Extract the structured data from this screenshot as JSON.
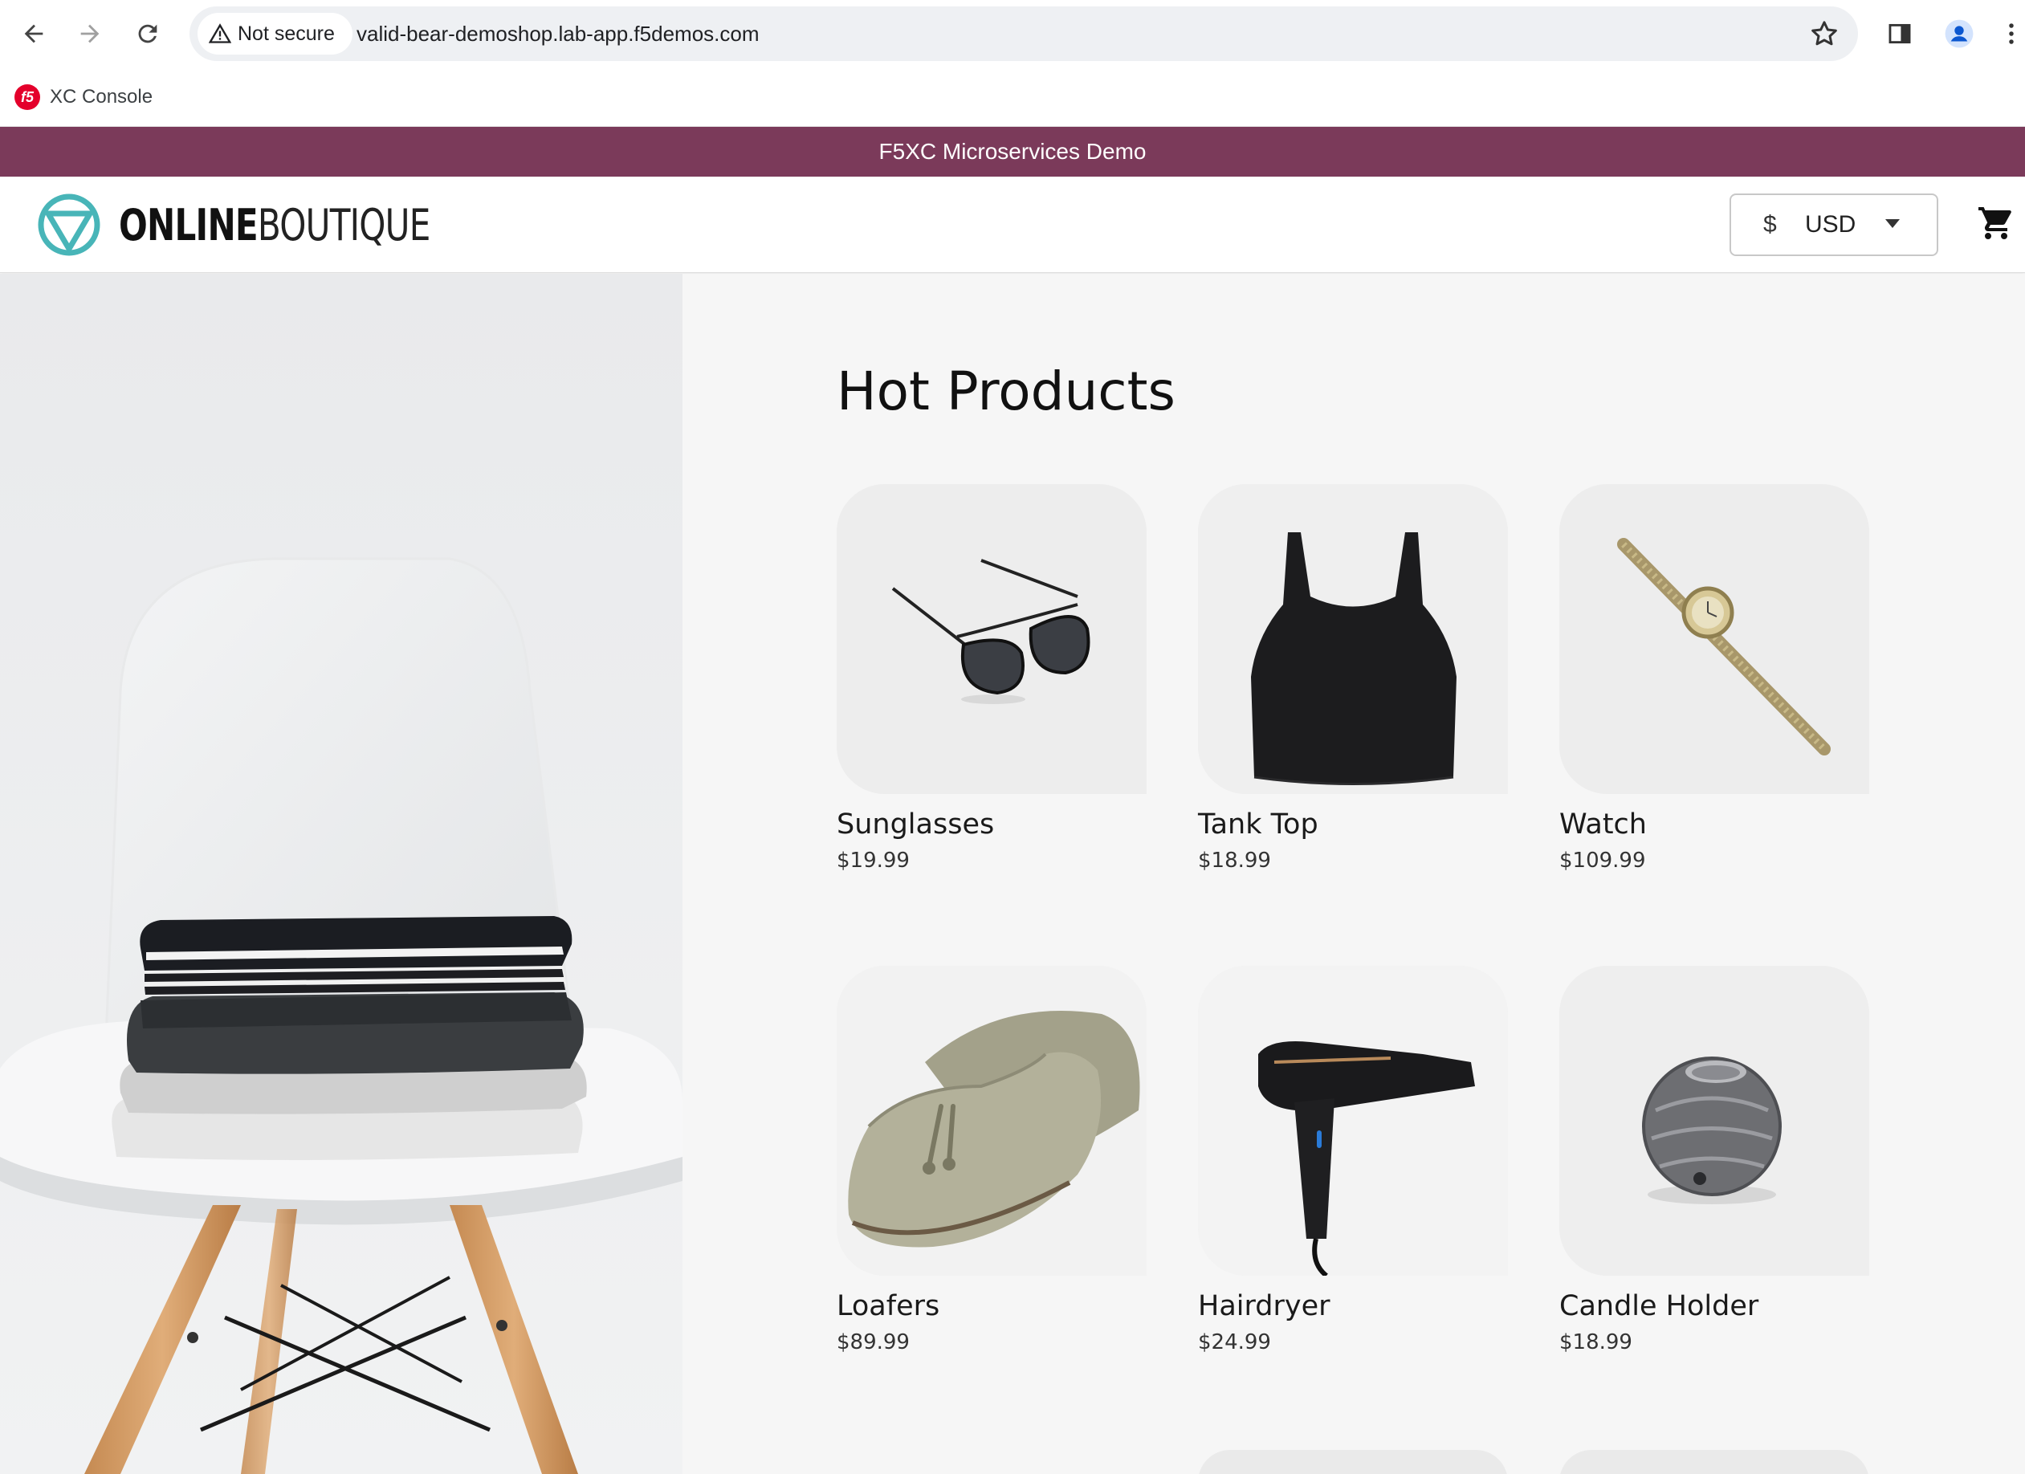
{
  "browser": {
    "security_label": "Not secure",
    "url": "valid-bear-demoshop.lab-app.f5demos.com",
    "bookmarks": [
      {
        "label": "XC Console",
        "icon": "f5-logo-icon"
      }
    ]
  },
  "banner": {
    "text": "F5XC Microservices Demo"
  },
  "header": {
    "logo_bold": "ONLINE",
    "logo_light": "BOUTIQUE",
    "currency_symbol": "$",
    "currency_code": "USD"
  },
  "main": {
    "heading": "Hot Products",
    "products": [
      {
        "name": "Sunglasses",
        "price": "$19.99",
        "image": "sunglasses"
      },
      {
        "name": "Tank Top",
        "price": "$18.99",
        "image": "tank-top"
      },
      {
        "name": "Watch",
        "price": "$109.99",
        "image": "watch"
      },
      {
        "name": "Loafers",
        "price": "$89.99",
        "image": "loafers"
      },
      {
        "name": "Hairdryer",
        "price": "$24.99",
        "image": "hairdryer"
      },
      {
        "name": "Candle Holder",
        "price": "$18.99",
        "image": "candle-holder"
      }
    ]
  },
  "colors": {
    "banner": "#7b3a5a",
    "logo_accent": "#48b5b8"
  }
}
